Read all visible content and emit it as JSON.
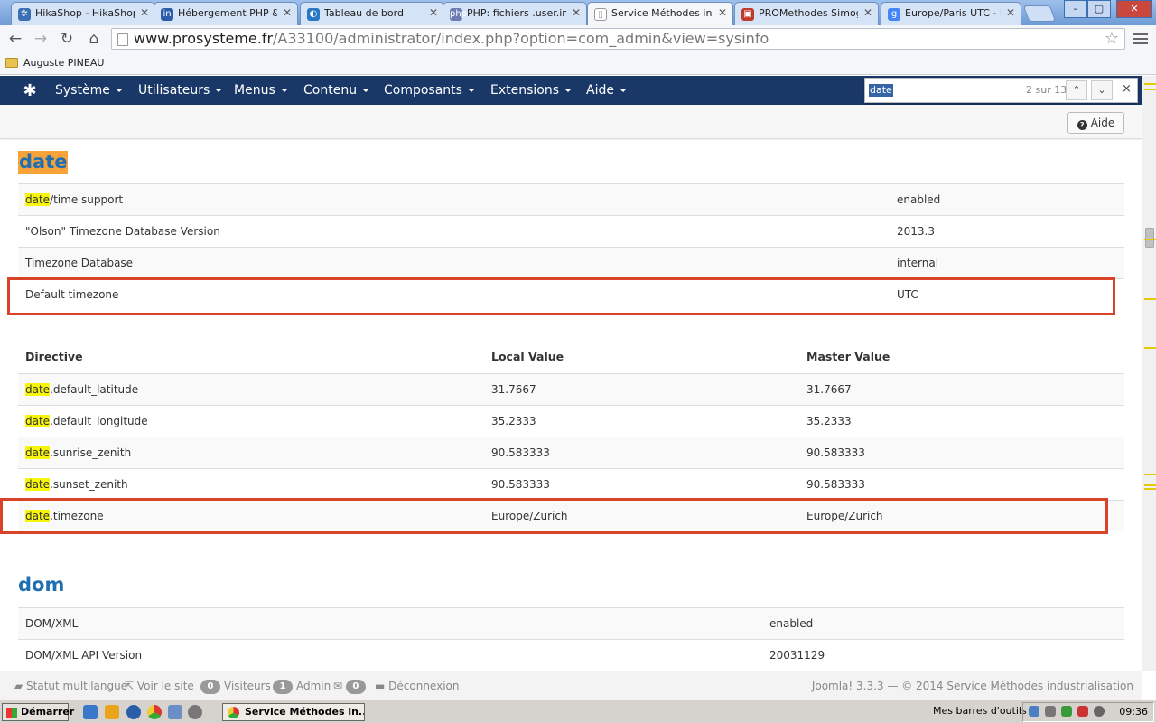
{
  "browser": {
    "tabs": [
      {
        "label": "HikaShop - HikaShop",
        "favicon_color": "#3a6fb3",
        "favicon_glyph": "✲"
      },
      {
        "label": "Hébergement PHP & M",
        "favicon_color": "#2c5da8",
        "favicon_glyph": "in"
      },
      {
        "label": "Tableau de bord",
        "favicon_color": "#2a78c5",
        "favicon_glyph": "◐"
      },
      {
        "label": "PHP: fichiers .user.ini",
        "favicon_color": "#6c7bb4",
        "favicon_glyph": "php"
      },
      {
        "label": "Service Méthodes indu",
        "favicon_color": "#ffffff",
        "favicon_glyph": "▯"
      },
      {
        "label": "PROMethodes Simogr",
        "favicon_color": "#c0392b",
        "favicon_glyph": "▣"
      },
      {
        "label": "Europe/Paris UTC - Re",
        "favicon_color": "#4285f4",
        "favicon_glyph": "g"
      }
    ],
    "active_tab": 4,
    "url_host": "www.prosysteme.fr",
    "url_path": "/A33100/administrator/index.php?option=com_admin&view=sysinfo",
    "bookmark": "Auguste PINEAU",
    "window_controls": {
      "minimize": "–",
      "maximize": "▢",
      "close": "✕"
    }
  },
  "find": {
    "query": "date",
    "count": "2 sur 13",
    "prev": "⌃",
    "next": "⌄",
    "close": "×"
  },
  "joomla_nav": {
    "logo": "✱",
    "items": [
      "Système",
      "Utilisateurs",
      "Menus",
      "Contenu",
      "Composants",
      "Extensions",
      "Aide"
    ]
  },
  "subbar": {
    "help_label": "Aide",
    "help_icon": "?"
  },
  "sections": {
    "date": {
      "title": "date",
      "info_rows": [
        {
          "hl": "date",
          "label": "/time support",
          "value": "enabled"
        },
        {
          "hl": "",
          "label": "\"Olson\" Timezone Database Version",
          "value": "2013.3"
        },
        {
          "hl": "",
          "label": "Timezone Database",
          "value": "internal"
        },
        {
          "hl": "",
          "label": "Default timezone",
          "value": "UTC"
        }
      ],
      "directive_headers": {
        "directive": "Directive",
        "local": "Local Value",
        "master": "Master Value"
      },
      "directives": [
        {
          "hl": "date",
          "name": ".default_latitude",
          "local": "31.7667",
          "master": "31.7667"
        },
        {
          "hl": "date",
          "name": ".default_longitude",
          "local": "35.2333",
          "master": "35.2333"
        },
        {
          "hl": "date",
          "name": ".sunrise_zenith",
          "local": "90.583333",
          "master": "90.583333"
        },
        {
          "hl": "date",
          "name": ".sunset_zenith",
          "local": "90.583333",
          "master": "90.583333"
        },
        {
          "hl": "date",
          "name": ".timezone",
          "local": "Europe/Zurich",
          "master": "Europe/Zurich"
        }
      ]
    },
    "dom": {
      "title": "dom",
      "rows": [
        {
          "label": "DOM/XML",
          "value": "enabled"
        },
        {
          "label": "DOM/XML API Version",
          "value": "20031129"
        }
      ]
    }
  },
  "statusbar": {
    "multilang": "Statut multilangue",
    "view_site": "Voir le site",
    "visitors_count": "0",
    "visitors": "Visiteurs",
    "admin_count": "1",
    "admin": "Admin",
    "messages_count": "0",
    "logout": "Déconnexion",
    "footer": "Joomla! 3.3.3 — © 2014 Service Méthodes industrialisation"
  },
  "taskbar": {
    "start": "Démarrer",
    "task": "Service Méthodes in...",
    "toolbars": "Mes barres d'outils",
    "clock": "09:36"
  },
  "colors": {
    "nav": "#1a3867",
    "highlight": "#f6f50b",
    "active_match": "#f7a33a",
    "heading": "#1f6fb2",
    "redbox": "#d9432a"
  }
}
